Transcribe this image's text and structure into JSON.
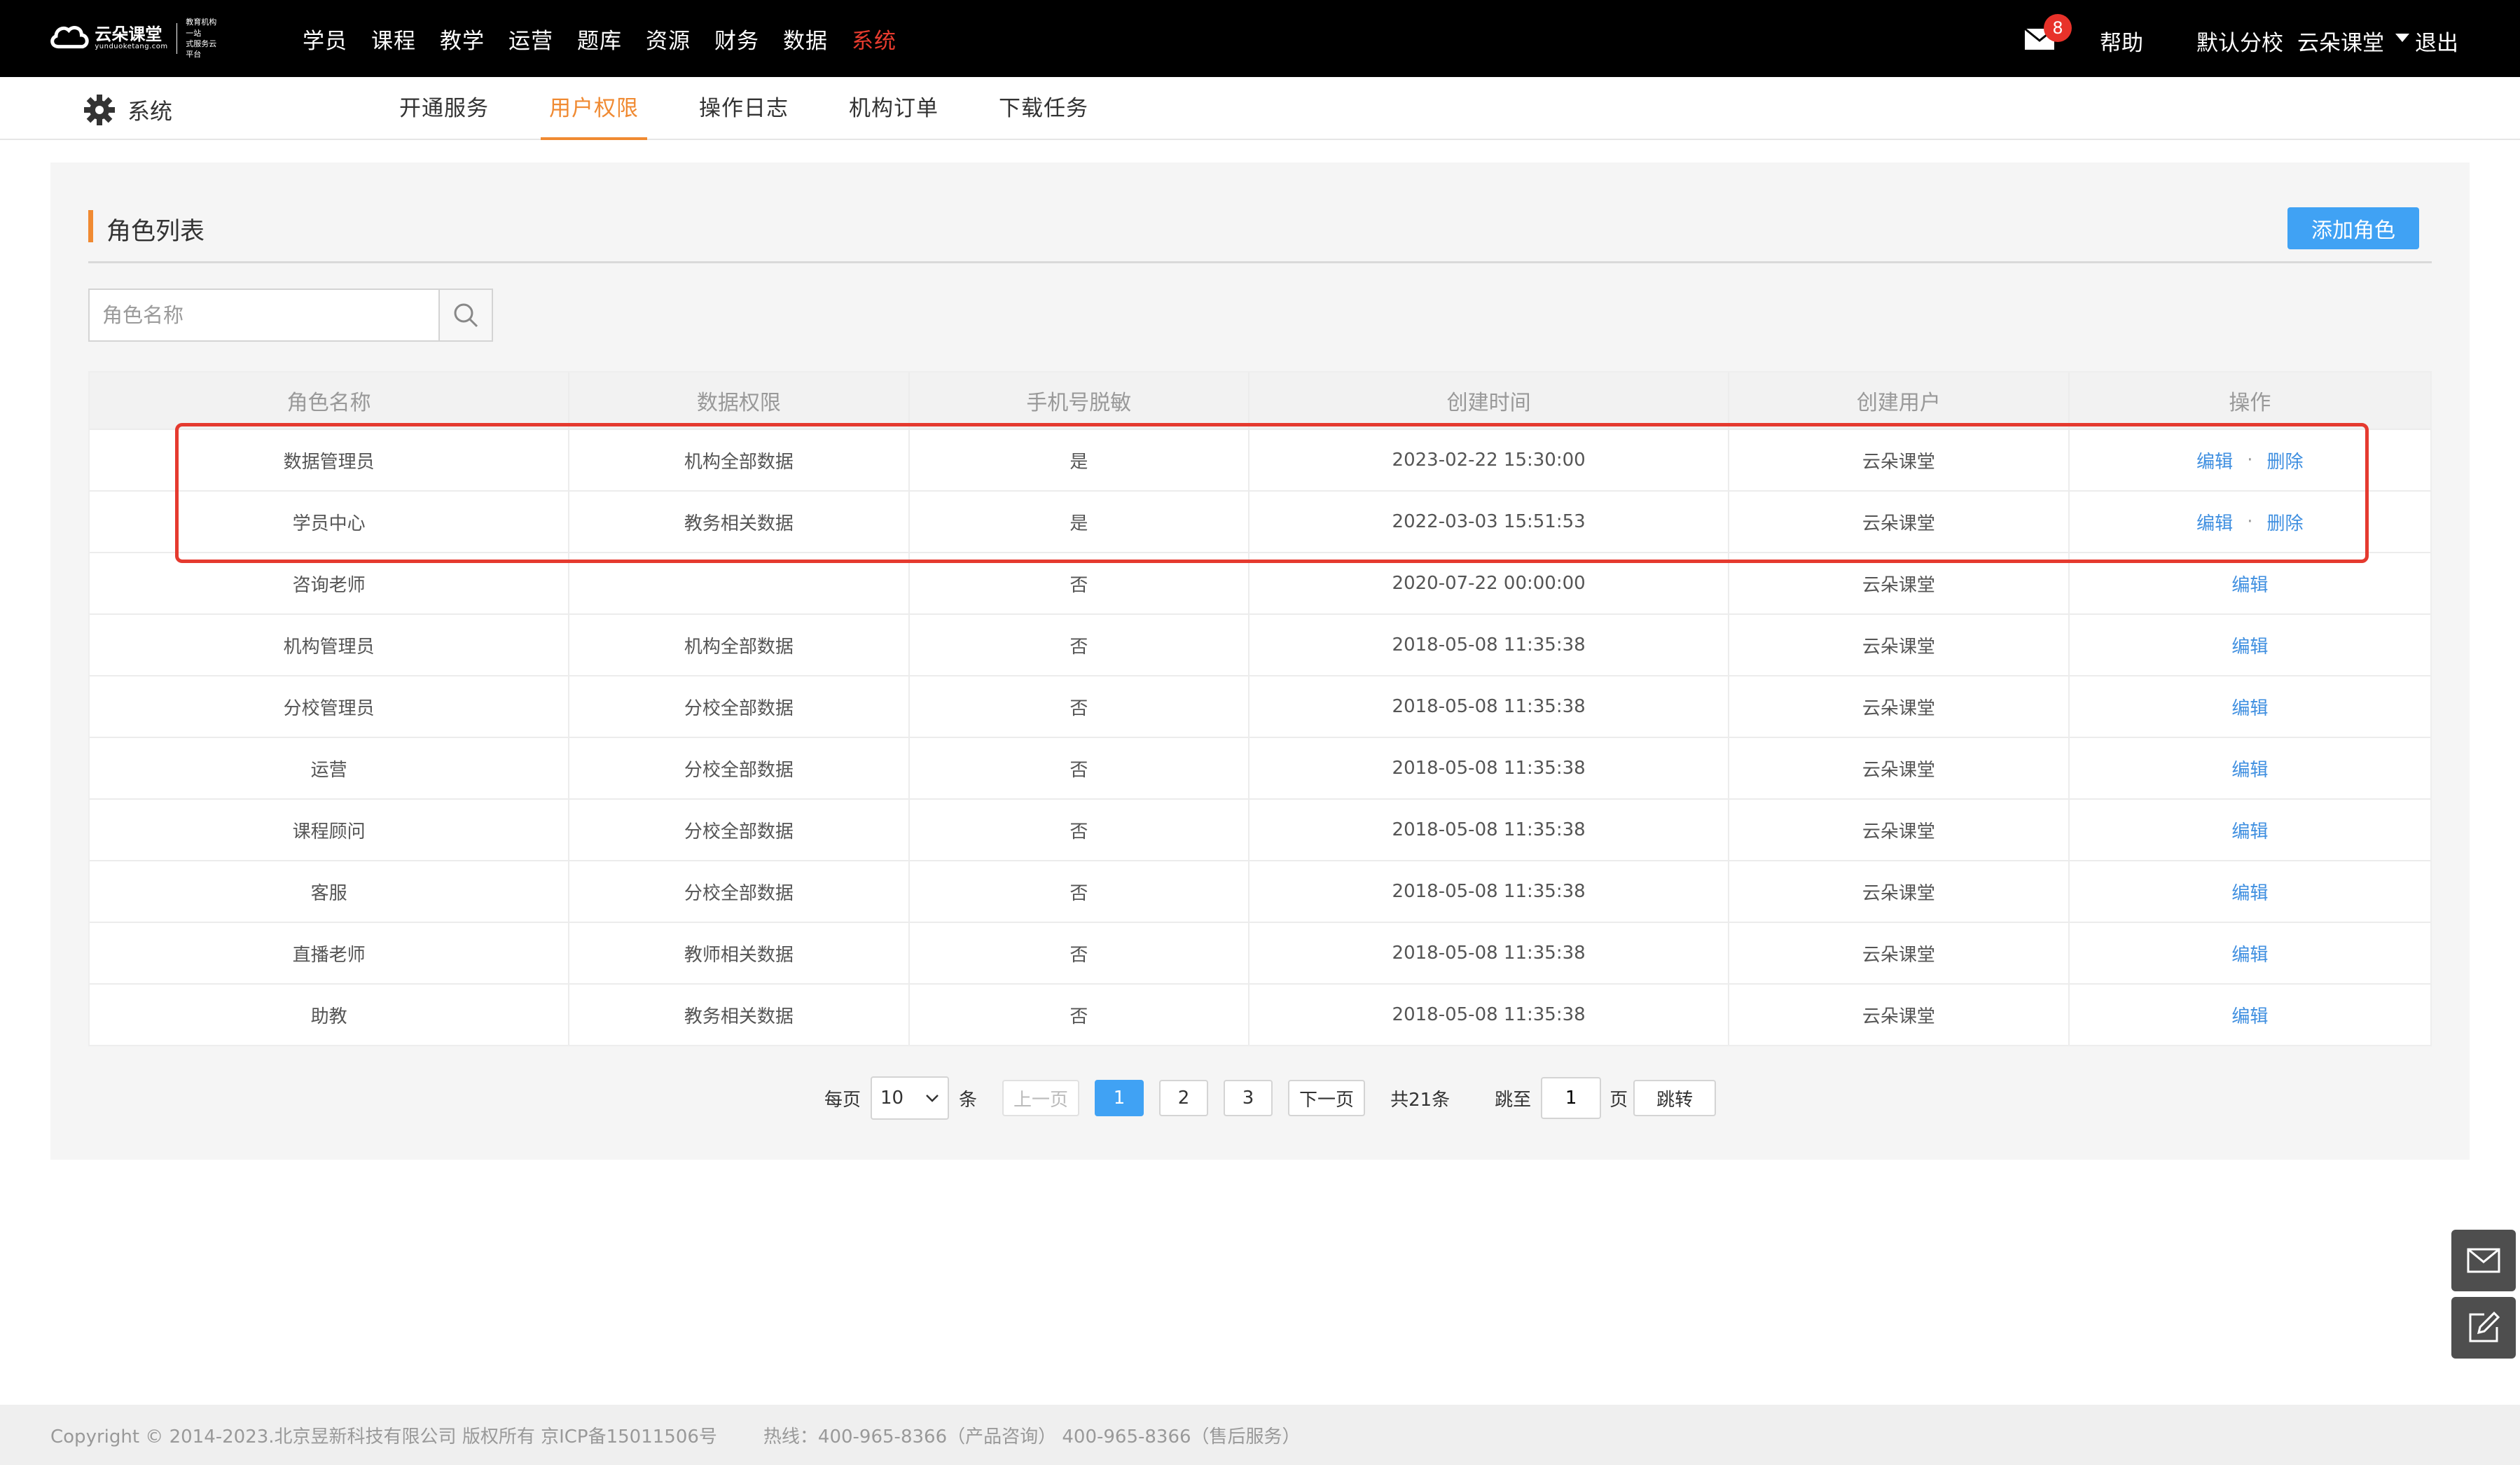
{
  "logo": {
    "name": "云朵课堂",
    "domain": "yunduoketang.com",
    "slogan_line1": "教育机构一站",
    "slogan_line2": "式服务云平台"
  },
  "mainnav": [
    "学员",
    "课程",
    "教学",
    "运营",
    "题库",
    "资源",
    "财务",
    "数据",
    "系统"
  ],
  "mainnav_active": "系统",
  "topright": {
    "mail_badge": "8",
    "help": "帮助",
    "branch": "默认分校",
    "user": "云朵课堂",
    "logout": "退出"
  },
  "subbar": {
    "title": "系统",
    "tabs": [
      "开通服务",
      "用户权限",
      "操作日志",
      "机构订单",
      "下载任务"
    ],
    "active_tab": "用户权限"
  },
  "section": {
    "title": "角色列表",
    "add_button": "添加角色",
    "search_placeholder": "角色名称"
  },
  "table": {
    "columns": [
      "角色名称",
      "数据权限",
      "手机号脱敏",
      "创建时间",
      "创建用户",
      "操作"
    ],
    "rows": [
      {
        "name": "数据管理员",
        "scope": "机构全部数据",
        "mask": "是",
        "created": "2023-02-22 15:30:00",
        "creator": "云朵课堂",
        "edit": "编辑",
        "delete": "删除"
      },
      {
        "name": "学员中心",
        "scope": "教务相关数据",
        "mask": "是",
        "created": "2022-03-03 15:51:53",
        "creator": "云朵课堂",
        "edit": "编辑",
        "delete": "删除"
      },
      {
        "name": "咨询老师",
        "scope": "",
        "mask": "否",
        "created": "2020-07-22 00:00:00",
        "creator": "云朵课堂",
        "edit": "编辑",
        "delete": ""
      },
      {
        "name": "机构管理员",
        "scope": "机构全部数据",
        "mask": "否",
        "created": "2018-05-08 11:35:38",
        "creator": "云朵课堂",
        "edit": "编辑",
        "delete": ""
      },
      {
        "name": "分校管理员",
        "scope": "分校全部数据",
        "mask": "否",
        "created": "2018-05-08 11:35:38",
        "creator": "云朵课堂",
        "edit": "编辑",
        "delete": ""
      },
      {
        "name": "运营",
        "scope": "分校全部数据",
        "mask": "否",
        "created": "2018-05-08 11:35:38",
        "creator": "云朵课堂",
        "edit": "编辑",
        "delete": ""
      },
      {
        "name": "课程顾问",
        "scope": "分校全部数据",
        "mask": "否",
        "created": "2018-05-08 11:35:38",
        "creator": "云朵课堂",
        "edit": "编辑",
        "delete": ""
      },
      {
        "name": "客服",
        "scope": "分校全部数据",
        "mask": "否",
        "created": "2018-05-08 11:35:38",
        "creator": "云朵课堂",
        "edit": "编辑",
        "delete": ""
      },
      {
        "name": "直播老师",
        "scope": "教师相关数据",
        "mask": "否",
        "created": "2018-05-08 11:35:38",
        "creator": "云朵课堂",
        "edit": "编辑",
        "delete": ""
      },
      {
        "name": "助教",
        "scope": "教务相关数据",
        "mask": "否",
        "created": "2018-05-08 11:35:38",
        "creator": "云朵课堂",
        "edit": "编辑",
        "delete": ""
      }
    ]
  },
  "pager": {
    "per_page_label": "每页",
    "per_page_value": "10",
    "per_page_unit": "条",
    "prev": "上一页",
    "pages": [
      "1",
      "2",
      "3"
    ],
    "current_page": "1",
    "next": "下一页",
    "total": "共21条",
    "jump_label": "跳至",
    "jump_value": "1",
    "page_unit": "页",
    "jump_button": "跳转"
  },
  "footer": {
    "copyright": "Copyright © 2014-2023.北京昱新科技有限公司 版权所有 京ICP备15011506号",
    "hotline": "热线：400-965-8366（产品咨询） 400-965-8366（售后服务）"
  },
  "colors": {
    "topbar_bg": "#000000",
    "nav_active": "#e83b2e",
    "accent_orange": "#f08a32",
    "primary_blue": "#40a2f4",
    "link_blue": "#3f8fe0",
    "highlight_red": "#e53a2f"
  },
  "icons": {
    "gear": "gear-icon",
    "mail": "mail-icon",
    "search": "search-icon",
    "dropdown": "caret-down-icon",
    "float_mail": "envelope-icon",
    "float_edit": "edit-icon"
  }
}
